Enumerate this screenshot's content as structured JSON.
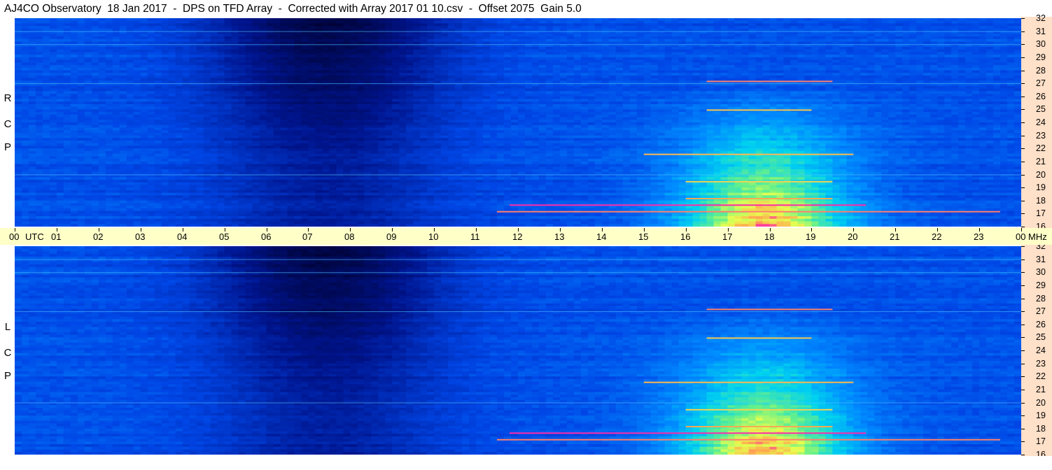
{
  "title": "AJ4CO Observatory  18 Jan 2017  -  DPS on TFD Array  -  Corrected with Array 2017 01 10.csv  -  Offset 2075  Gain 5.0",
  "chart_data": {
    "type": "heatmap",
    "title": "AJ4CO Observatory  18 Jan 2017  -  DPS on TFD Array  -  Corrected with Array 2017 01 10.csv  -  Offset 2075  Gain 5.0",
    "x_unit": "UTC",
    "y_unit": "MHz",
    "x_range": [
      0,
      24
    ],
    "y_range": [
      16,
      32
    ],
    "x_ticks": [
      "00",
      "01",
      "02",
      "03",
      "04",
      "05",
      "06",
      "07",
      "08",
      "09",
      "10",
      "11",
      "12",
      "13",
      "14",
      "15",
      "16",
      "17",
      "18",
      "19",
      "20",
      "21",
      "22",
      "23",
      "00"
    ],
    "y_ticks": [
      "16",
      "17",
      "18",
      "19",
      "20",
      "21",
      "22",
      "23",
      "24",
      "25",
      "26",
      "27",
      "28",
      "29",
      "30",
      "31",
      "32"
    ],
    "panels": [
      {
        "name": "RCP",
        "letters": [
          "R",
          "C",
          "P"
        ]
      },
      {
        "name": "LCP",
        "letters": [
          "L",
          "C",
          "P"
        ]
      }
    ],
    "colors": {
      "low": "#000040",
      "mid": "#0066ff",
      "high": "#ffff40",
      "peak": "#ff00c0"
    }
  }
}
